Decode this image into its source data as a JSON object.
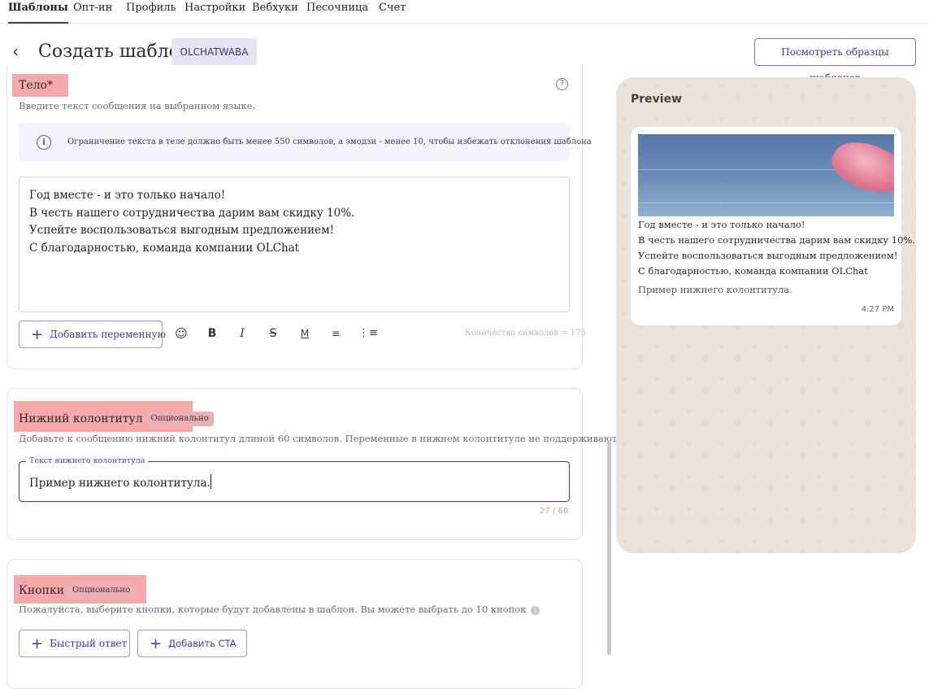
{
  "nav": {
    "tabs": [
      "Шаблоны",
      "Опт-ин",
      "Профиль",
      "Настройки",
      "Вебхуки",
      "Песочница",
      "Счет"
    ]
  },
  "header": {
    "title": "Создать шаблон",
    "chip": "OLCHATWABA",
    "samples_button": "Посмотреть образцы шаблонов"
  },
  "body_section": {
    "title": "Тело*",
    "description": "Введите текст сообщения на выбранном языке.",
    "info_text": "Ограничение текста в теле должно быть менее 550 символов, а эмодзи - менее 10, чтобы избежать отклонения шаблона",
    "lines": [
      "Год вместе - и это только начало!",
      "В честь нашего сотрудничества дарим вам скидку 10%.",
      "Успейте воспользоваться выгодным предложением!",
      "С благодарностью, команда компании OLChat"
    ],
    "add_variable_button": "Добавить переменную",
    "char_count": "Количество символов = 175",
    "toolbar_icons": [
      "emoji-icon",
      "bold-icon",
      "italic-icon",
      "strikethrough-icon",
      "monospace-icon",
      "numbered-list-icon",
      "bullet-list-icon"
    ]
  },
  "footer_section": {
    "title": "Нижний колонтитул",
    "optional": "Опционально",
    "description": "Добавьте к сообщению нижний колонтитул длиной 60 символов. Переменные в нижнем колонтитуле не поддерживаются.",
    "field_label": "Текст нижнего колонтитула",
    "field_value": "Пример нижнего колонтитула.",
    "counter": "27 / 60"
  },
  "buttons_section": {
    "title": "Кнопки",
    "optional": "Опционально",
    "description": "Пожалуйста, выберите кнопки, которые будут добавлены в шаблон. Вы можете выбрать до 10 кнопок",
    "quick_reply_button": "Быстрый ответ",
    "add_cta_button": "Добавить CTA"
  },
  "preview": {
    "title": "Preview",
    "lines": [
      "Год вместе - и это только начало!",
      "В честь нашего сотрудничества дарим вам скидку 10%.",
      "Успейте воспользоваться выгодным предложением!",
      "С благодарностью, команда компании OLChat"
    ],
    "footer": "Пример нижнего колонтитула.",
    "time": "4:27 PM"
  },
  "colors": {
    "accent": "#3c3aa0",
    "highlight": "#f7a8a8",
    "preview_bg": "#e9e3dc"
  }
}
